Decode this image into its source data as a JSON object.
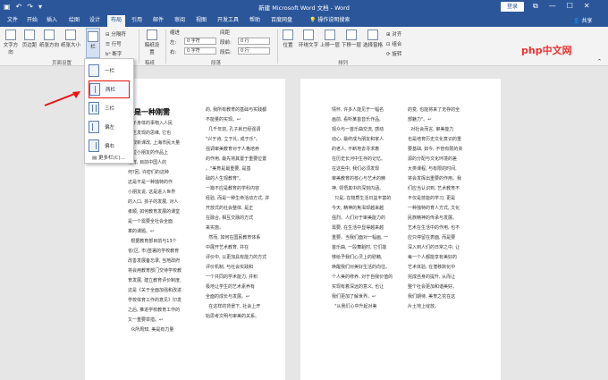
{
  "window": {
    "title": "新建 Microsoft Word 文档 - Word",
    "login": "登录",
    "share": "共享"
  },
  "tabs": [
    "文件",
    "开始",
    "插入",
    "绘图",
    "设计",
    "布局",
    "引用",
    "邮件",
    "审阅",
    "视图",
    "开发工具",
    "帮助",
    "百度网盘",
    "操作说明搜索"
  ],
  "ribbon": {
    "page_setup": {
      "label": "页面设置",
      "text_direction": "文字方向",
      "margins": "页边距",
      "orientation": "纸张方向",
      "size": "纸张大小",
      "columns": "栏",
      "breaks": "分隔符",
      "line_numbers": "行号",
      "hyphenation": "断字"
    },
    "draft": {
      "label": "稿纸",
      "settings": "稿纸设置"
    },
    "paragraph": {
      "label": "段落",
      "indent": "缩进",
      "spacing": "间距",
      "left": "左:",
      "right": "右:",
      "before": "段前:",
      "after": "段后:",
      "left_val": "0 字符",
      "right_val": "0 字符",
      "before_val": "0 行",
      "after_val": "0 行"
    },
    "arrange": {
      "label": "排列",
      "position": "位置",
      "wrap": "环绕文字",
      "forward": "上移一层",
      "backward": "下移一层",
      "selection": "选择窗格",
      "align": "对齐",
      "group": "组合",
      "rotate": "旋转"
    }
  },
  "columns_menu": {
    "one": "一栏",
    "two": "两栏",
    "three": "三栏",
    "left": "偏左",
    "right": "偏右",
    "more": "更多栏(C)..."
  },
  "document": {
    "heading": "育是一种刚需",
    "page1_col1": "对教育并不重视...",
    "page1_col2": "的, 所有教育的基础与实践都...",
    "page2_col1": "情怀, 许多人能见于一幅...",
    "page2_col2": "的变, 也能将来了无存的...",
    "page1_col1_lines": [
      "孩子身体的事物入人民",
      "缺乏发现的思维, 它也",
      "获取新课改, 上海市民大量",
      "一位小朋友的作品上",
      "这样, 目前中国人的",
      "何?回, 许密们的这种",
      "这是不是一种独特的作",
      "小朋友说, 这是进入世界",
      "的入口, 孩子的发展, 对人",
      "孝顺, 如何教育发展的课堂",
      "是一个需要全社会全面",
      "革的课题。↩",
      "  根据教育部目前与13个",
      "省(区, 市)签署的学校教育",
      "改善发展备忘录, 当地政府",
      "将会用教育部门交待学校教",
      "育发展, 建立教育评价制度,",
      "这是《关于全面加强和改进",
      "学校体育工作的意见》印发",
      "之后, 推进学校教育工作的",
      "又一重要举措。↩",
      "  众所周知, 美是有力量"
    ],
    "page1_col2_lines": [
      "的, 我所有教育的基础与实践都",
      "不能量的实现。↩",
      "  几千年前, 孔子就已经强调",
      "\"兴于诗, 立于礼, 成于乐\"。",
      "强调审美教育对于人格培养",
      "的作用, 最先将其置于重要位置",
      "。\"美育是最重要, 是基",
      "础的人生观教育\"。",
      "一篇不应是教育的学科内容",
      "经验, 而是一种生命活动方式, 并",
      "开放式的社会整体, 是正",
      "在融合, 相互交融的方式",
      "来实施。",
      "  然而, 如何在国民教育体系",
      "中展开艺术教育, 并在",
      "评价中, 以更加具有能力的方式",
      "评价机制, 与社会实践和",
      "一个共同的学术能力, 并积",
      "极地让学生的艺术素养有",
      "全面的成长与发展。↩",
      "  在这样的背景下, 社会上开",
      "始思考文明与审美的关系。"
    ],
    "page2_col1_lines": [
      "情怀, 许多人能见于一幅名",
      "画前, 看听某首音乐作品,",
      "观众与一首乐曲交流, 感动",
      "动心, 最终成为朋友和家人",
      "的老人, 不断地去寻求着",
      "在历史长河中生存的记忆。",
      "在这些中, 我们必须发现",
      "审美教育的核心与艺术的精",
      "神, 领悟其中的深刻内涵。",
      "  只是, 在物质生活日益丰富的",
      "今天, 精神的焦渴却越来越",
      "强烈。人们对于审美能力的",
      "需要, 在生活中显得越来越",
      "重要。当我们面对一幅画, 一",
      "首乐曲, 一段舞蹈时, 它们能",
      "够给予我们心灵上的慰藉,",
      "唤醒我们对美好生活的向往。",
      "个人美的修养, 对于自我价值的",
      "实现有着深远的意义, 也让",
      "我们更加了解世界。↩",
      "  \"从我们心中升起对美"
    ],
    "page2_col2_lines": [
      "的变, 也能将来了无存的全",
      "部魅力\"。↩",
      "",
      "  对社会而言, 审美能力",
      "也是培育历史文化意识的重",
      "要基础, 如今, 不管有限的资",
      "源的分配与文化环境的差",
      "大类课程, 与有限的时间,",
      "将会发挥出重要的作用。我",
      "们应当认识到, 艺术教育不",
      "不仅是技能的学习, 更是",
      "一种独特的育人方式, 文化",
      "民族精神的传承与发展。",
      "艺术在生活中的作用, 也不",
      "应只停留在表面, 而是要",
      "深入到人们的日常之中, 让",
      "每一个人都能享有美好的",
      "艺术体验, 在潜移默化中",
      "完成自身的提升, 从而让",
      "整个社会更加和谐美好。",
      "我们期待, 美育之花在这",
      "片土地上绽放。"
    ]
  },
  "watermark": "php中文网"
}
